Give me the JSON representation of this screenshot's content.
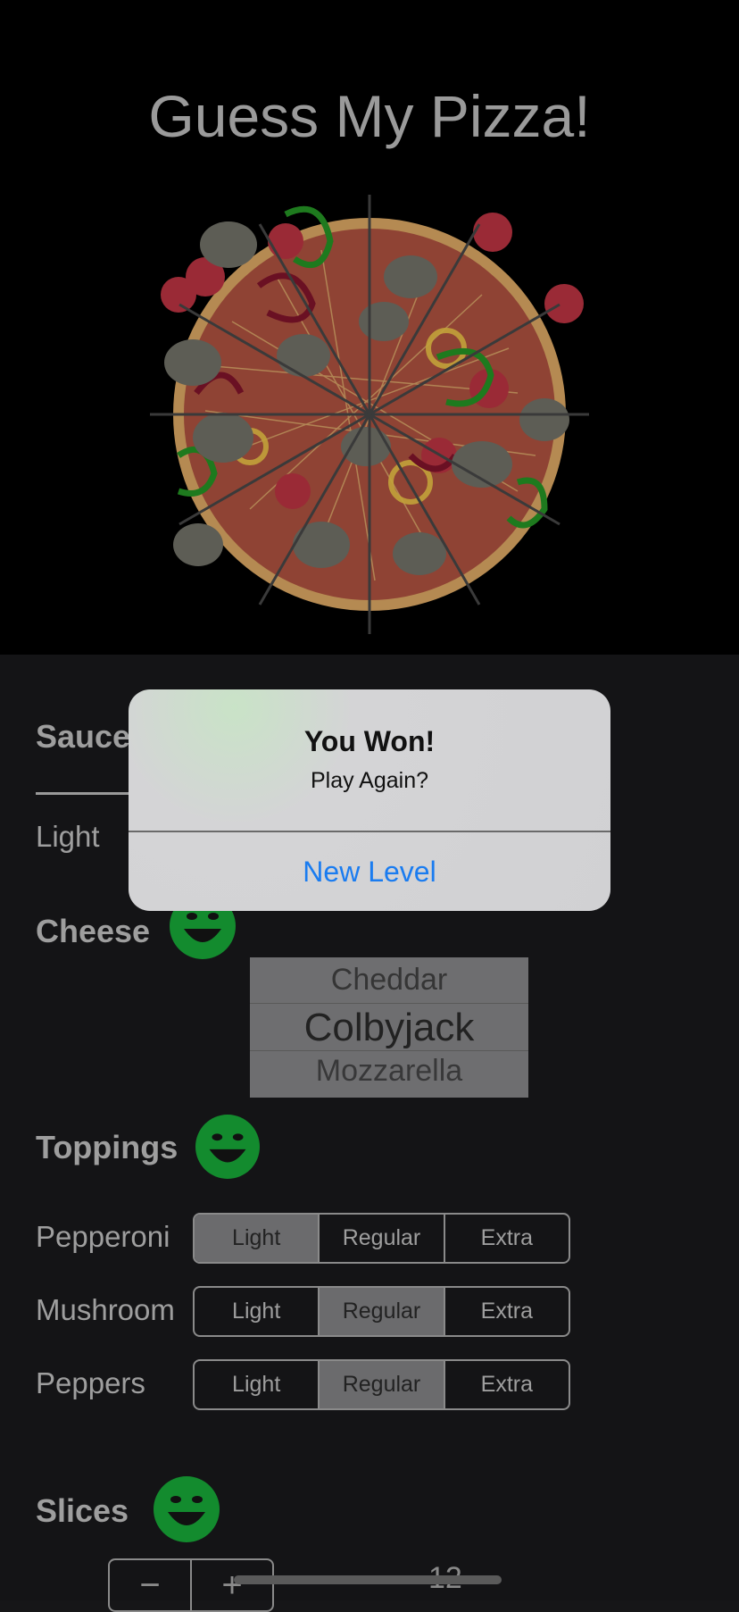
{
  "app": {
    "title": "Guess My Pizza!"
  },
  "sauce": {
    "label": "Sauce",
    "selected": "Light"
  },
  "cheese": {
    "label": "Cheese",
    "picker_options": [
      "Cheddar",
      "Colbyjack",
      "Mozzarella"
    ],
    "selected": "Colbyjack"
  },
  "toppings": {
    "label": "Toppings",
    "options": [
      "Light",
      "Regular",
      "Extra"
    ],
    "rows": [
      {
        "name": "Pepperoni",
        "selected": "Light"
      },
      {
        "name": "Mushroom",
        "selected": "Regular"
      },
      {
        "name": "Peppers",
        "selected": "Regular"
      }
    ]
  },
  "slices": {
    "label": "Slices",
    "minus": "−",
    "plus": "+",
    "count": "12"
  },
  "alert": {
    "title": "You Won!",
    "message": "Play Again?",
    "button": "New Level"
  },
  "colors": {
    "smiley": "#138b2e",
    "accent": "#1a7cf0",
    "crust": "#b58a52",
    "sauce": "#8f4334"
  }
}
